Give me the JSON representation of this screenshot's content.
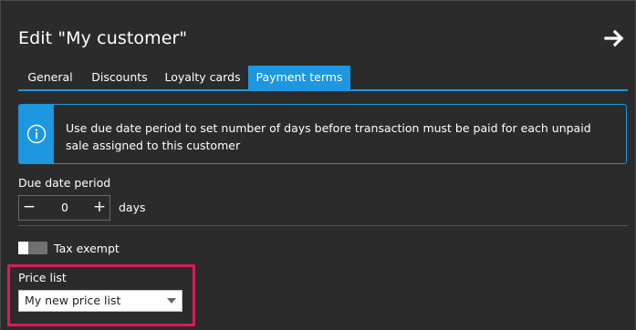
{
  "dialog": {
    "title": "Edit \"My customer\""
  },
  "tabs": [
    {
      "label": "General",
      "active": false
    },
    {
      "label": "Discounts",
      "active": false
    },
    {
      "label": "Loyalty cards",
      "active": false
    },
    {
      "label": "Payment terms",
      "active": true
    }
  ],
  "info_message": "Use due date period to set number of days before transaction must be paid for each unpaid sale assigned to this customer",
  "due_date": {
    "label": "Due date period",
    "value": "0",
    "unit": "days",
    "minus": "−",
    "plus": "+"
  },
  "tax_exempt": {
    "label": "Tax exempt",
    "checked": false
  },
  "price_list": {
    "label": "Price list",
    "selected": "My new price list"
  },
  "colors": {
    "background": "#2b2b2b",
    "accent": "#1c97e0",
    "highlight": "#e0195a"
  },
  "icons": {
    "close": "arrow-right-icon",
    "info": "info-circle-icon",
    "dropdown": "caret-down-icon"
  }
}
